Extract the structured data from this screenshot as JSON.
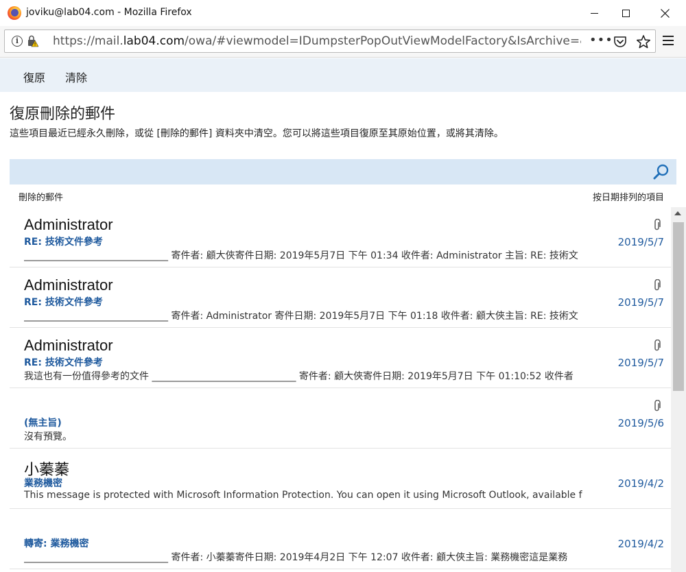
{
  "window": {
    "title": "joviku@lab04.com - Mozilla Firefox",
    "url_prefix": "https://mail.",
    "url_host": "lab04.com",
    "url_rest": "/owa/#viewmodel=IDumpsterPopOutViewModelFactory&IsArchive=&F",
    "url_more": "•••"
  },
  "toolbar": {
    "restore_label": "復原",
    "purge_label": "清除"
  },
  "page": {
    "title": "復原刪除的郵件",
    "description": "這些項目最近已經永久刪除，或從 [刪除的郵件] 資料夾中清空。您可以將這些項目復原至其原始位置，或將其清除。"
  },
  "list": {
    "header_left": "刪除的郵件",
    "header_right": "按日期排列的項目",
    "items": [
      {
        "sender": "Administrator",
        "subject": "RE: 技術文件參考",
        "preview": "______________________________ 寄件者: 顧大俠寄件日期: 2019年5月7日 下午 01:34 收件者: Administrator 主旨: RE: 技術文",
        "date": "2019/5/7",
        "has_attachment": true
      },
      {
        "sender": "Administrator",
        "subject": "RE: 技術文件參考",
        "preview": "______________________________ 寄件者: Administrator 寄件日期: 2019年5月7日 下午 01:18 收件者: 顧大俠主旨: RE: 技術文",
        "date": "2019/5/7",
        "has_attachment": true
      },
      {
        "sender": "Administrator",
        "subject": "RE: 技術文件參考",
        "preview": "我這也有一份值得參考的文件 ______________________________ 寄件者: 顧大俠寄件日期: 2019年5月7日 下午 01:10:52 收件者",
        "date": "2019/5/7",
        "has_attachment": true
      },
      {
        "sender": "",
        "subject": "(無主旨)",
        "preview": "沒有預覽。",
        "date": "2019/5/6",
        "has_attachment": true
      },
      {
        "sender": "小蓁蓁",
        "subject": "業務機密",
        "preview": "This message is protected with Microsoft Information Protection. You can open it using Microsoft Outlook, available f",
        "date": "2019/4/2",
        "has_attachment": false
      },
      {
        "sender": "",
        "subject": "轉寄: 業務機密",
        "preview": "______________________________ 寄件者: 小蓁蓁寄件日期: 2019年4月2日 下午 12:07 收件者: 顧大俠主旨: 業務機密這是業務",
        "date": "2019/4/2",
        "has_attachment": false
      }
    ]
  },
  "colors": {
    "accent": "#1f5a9e",
    "command_bar": "#eaf1f8",
    "search_bar": "#d8e7f5"
  }
}
